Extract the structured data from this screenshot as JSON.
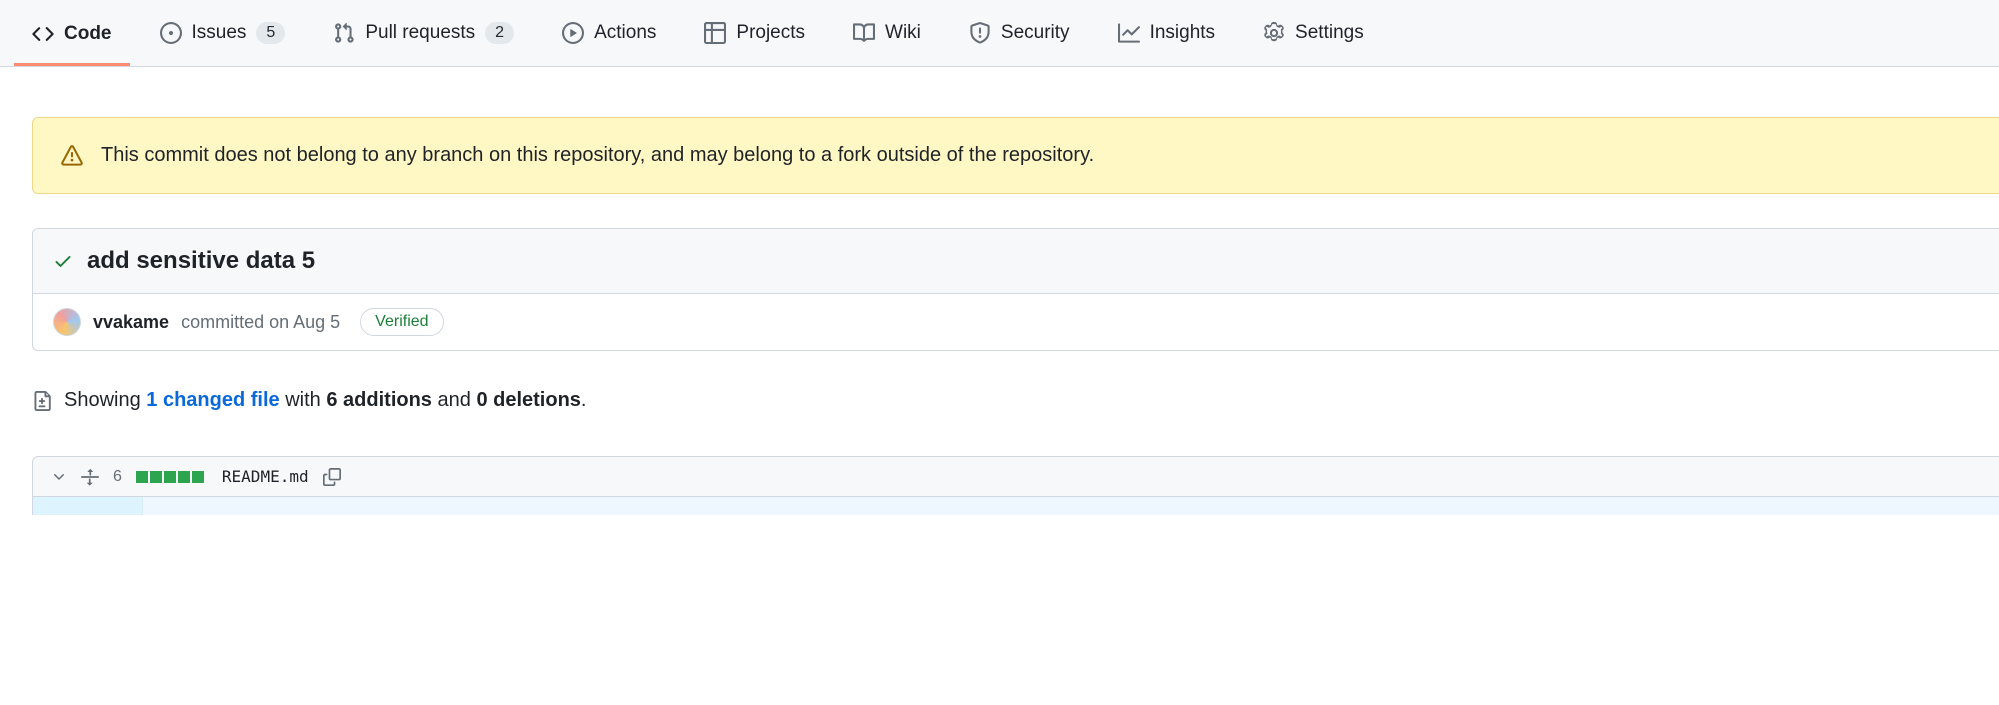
{
  "nav": {
    "code": "Code",
    "issues": "Issues",
    "issues_count": "5",
    "pulls": "Pull requests",
    "pulls_count": "2",
    "actions": "Actions",
    "projects": "Projects",
    "wiki": "Wiki",
    "security": "Security",
    "insights": "Insights",
    "settings": "Settings"
  },
  "flash": {
    "text": "This commit does not belong to any branch on this repository, and may belong to a fork outside of the repository."
  },
  "commit": {
    "title": "add sensitive data 5",
    "author": "vvakame",
    "committed_text": "committed on Aug 5",
    "verified_label": "Verified"
  },
  "diffstat": {
    "showing": "Showing",
    "changed_files_link": "1 changed file",
    "with": "with",
    "additions": "6 additions",
    "and": "and",
    "deletions": "0 deletions",
    "period": "."
  },
  "file": {
    "changes_count": "6",
    "name": "README.md"
  }
}
